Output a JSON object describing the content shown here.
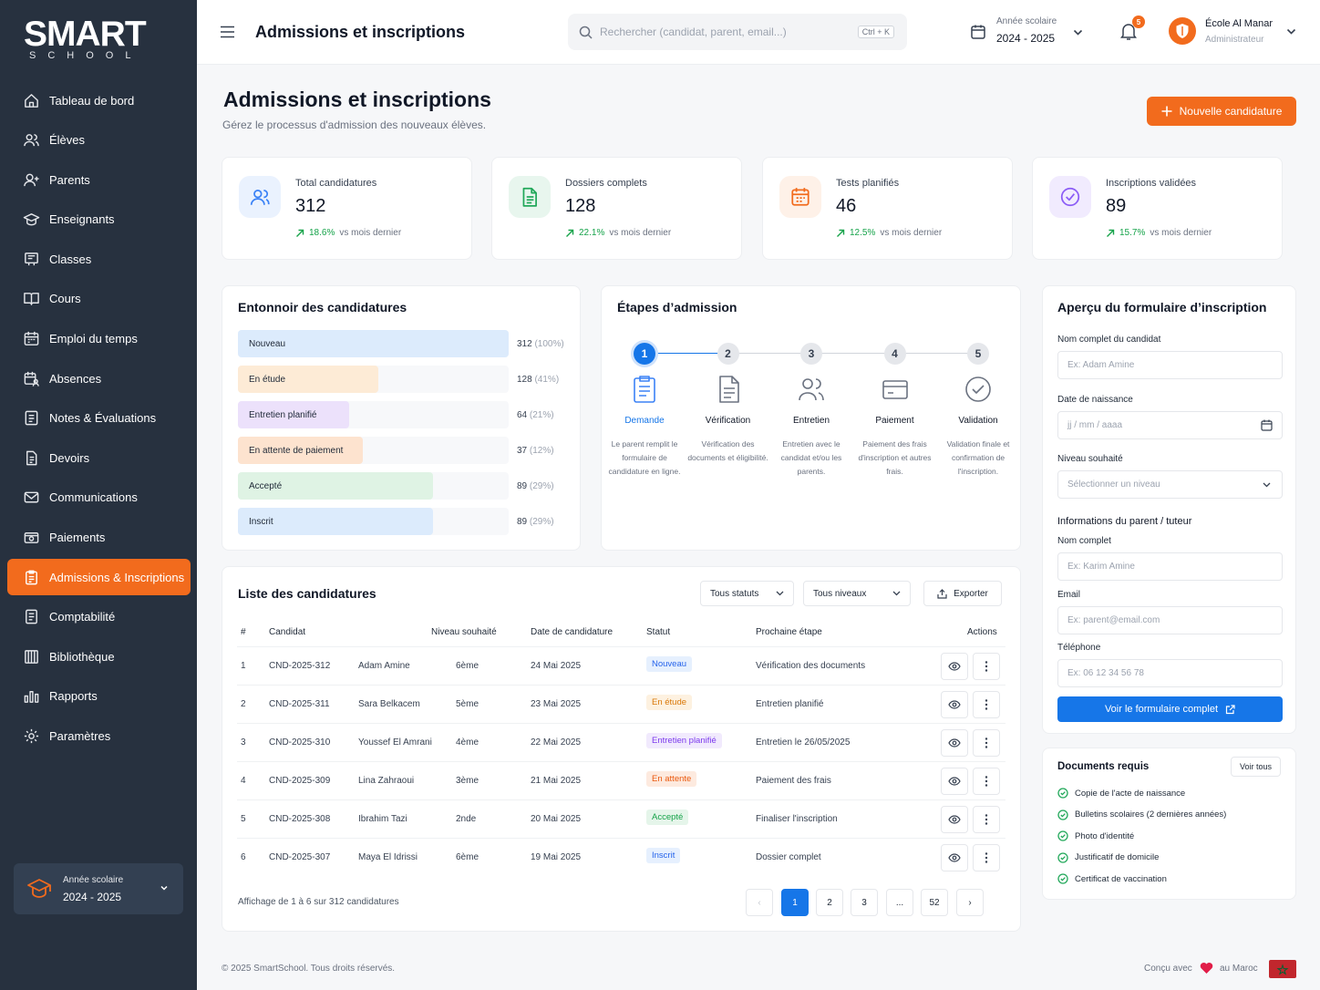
{
  "brand": {
    "name_main": "SMART",
    "name_sub": "SCHOOL"
  },
  "sidebar": {
    "items": [
      {
        "label": "Tableau de bord",
        "icon": "home-icon"
      },
      {
        "label": "Élèves",
        "icon": "users-icon"
      },
      {
        "label": "Parents",
        "icon": "user-plus-icon"
      },
      {
        "label": "Enseignants",
        "icon": "graduation-cap-icon"
      },
      {
        "label": "Classes",
        "icon": "board-icon"
      },
      {
        "label": "Cours",
        "icon": "book-icon"
      },
      {
        "label": "Emploi du temps",
        "icon": "calendar-icon"
      },
      {
        "label": "Absences",
        "icon": "calendar-user-icon"
      },
      {
        "label": "Notes & Évaluations",
        "icon": "notes-icon"
      },
      {
        "label": "Devoirs",
        "icon": "document-icon"
      },
      {
        "label": "Communications",
        "icon": "mail-icon"
      },
      {
        "label": "Paiements",
        "icon": "wallet-icon"
      },
      {
        "label": "Admissions & Inscriptions",
        "icon": "clipboard-icon",
        "active": true
      },
      {
        "label": "Comptabilité",
        "icon": "ledger-icon"
      },
      {
        "label": "Bibliothèque",
        "icon": "library-icon"
      },
      {
        "label": "Rapports",
        "icon": "bar-chart-icon"
      },
      {
        "label": "Paramètres",
        "icon": "gear-icon"
      }
    ],
    "year": {
      "label": "Année scolaire",
      "value": "2024 - 2025"
    }
  },
  "topbar": {
    "title": "Admissions et inscriptions",
    "search_placeholder": "Rechercher (candidat, parent, email...)",
    "shortcut": "Ctrl + K",
    "year_label": "Année scolaire",
    "year_value": "2024 - 2025",
    "notif_count": "5",
    "school_name": "École Al Manar",
    "role": "Administrateur"
  },
  "page": {
    "title": "Admissions et inscriptions",
    "subtitle": "Gérez le processus d'admission des nouveaux élèves.",
    "new_button": "Nouvelle candidature"
  },
  "stats": [
    {
      "label": "Total candidatures",
      "value": "312",
      "change": "18.6%",
      "suffix": "vs mois dernier",
      "color": "#3b82f6",
      "bg": "#eaf2fe"
    },
    {
      "label": "Dossiers complets",
      "value": "128",
      "change": "22.1%",
      "suffix": "vs mois dernier",
      "color": "#22a85a",
      "bg": "#e8f6ee"
    },
    {
      "label": "Tests planifiés",
      "value": "46",
      "change": "12.5%",
      "suffix": "vs mois dernier",
      "color": "#f26b1d",
      "bg": "#fef1e8"
    },
    {
      "label": "Inscriptions validées",
      "value": "89",
      "change": "15.7%",
      "suffix": "vs mois dernier",
      "color": "#8b5cf6",
      "bg": "#f1ebfe"
    }
  ],
  "funnel": {
    "title": "Entonnoir des candidatures",
    "rows": [
      {
        "label": "Nouveau",
        "count": "312",
        "pct": "(100%)",
        "fraction": 1.0,
        "color": "#dcebfc"
      },
      {
        "label": "En étude",
        "count": "128",
        "pct": "(41%)",
        "fraction": 0.52,
        "color": "#fdebd6"
      },
      {
        "label": "Entretien planifié",
        "count": "64",
        "pct": "(21%)",
        "fraction": 0.41,
        "color": "#ece1fb"
      },
      {
        "label": "En attente de paiement",
        "count": "37",
        "pct": "(12%)",
        "fraction": 0.46,
        "color": "#fde3cf"
      },
      {
        "label": "Accepté",
        "count": "89",
        "pct": "(29%)",
        "fraction": 0.72,
        "color": "#dff3e4"
      },
      {
        "label": "Inscrit",
        "count": "89",
        "pct": "(29%)",
        "fraction": 0.72,
        "color": "#dcebfc"
      }
    ]
  },
  "steps": {
    "title": "Étapes d’admission",
    "items": [
      {
        "num": "1",
        "title": "Demande",
        "desc": "Le parent remplit le formulaire de candidature en ligne.",
        "active": true
      },
      {
        "num": "2",
        "title": "Vérification",
        "desc": "Vérification des documents et éligibilité."
      },
      {
        "num": "3",
        "title": "Entretien",
        "desc": "Entretien avec le candidat et/ou les parents."
      },
      {
        "num": "4",
        "title": "Paiement",
        "desc": "Paiement des frais d'inscription et autres frais."
      },
      {
        "num": "5",
        "title": "Validation",
        "desc": "Validation finale et confirmation de l'inscription."
      }
    ]
  },
  "form": {
    "title": "Aperçu du formulaire d’inscription",
    "name_label": "Nom complet du candidat",
    "name_ph": "Ex: Adam Amine",
    "dob_label": "Date de naissance",
    "dob_ph": "jj / mm / aaaa",
    "level_label": "Niveau souhaité",
    "level_ph": "Sélectionner un niveau",
    "parent_section": "Informations du parent / tuteur",
    "pname_label": "Nom complet",
    "pname_ph": "Ex: Karim Amine",
    "email_label": "Email",
    "email_ph": "Ex: parent@email.com",
    "phone_label": "Téléphone",
    "phone_ph": "Ex: 06 12 34 56 78",
    "button": "Voir le formulaire complet"
  },
  "docs": {
    "title": "Documents requis",
    "see_all": "Voir tous",
    "items": [
      "Copie de l'acte de naissance",
      "Bulletins scolaires (2 dernières années)",
      "Photo d'identité",
      "Justificatif de domicile",
      "Certificat de vaccination"
    ]
  },
  "table": {
    "title": "Liste des candidatures",
    "filter_status": "Tous statuts",
    "filter_level": "Tous niveaux",
    "export": "Exporter",
    "headers": [
      "#",
      "Candidat",
      "Niveau souhaité",
      "Date de candidature",
      "Statut",
      "Prochaine étape",
      "Actions"
    ],
    "rows": [
      {
        "n": "1",
        "id": "CND-2025-312",
        "name": "Adam Amine",
        "level": "6ème",
        "date": "24 Mai 2025",
        "status": "Nouveau",
        "sfg": "#2563eb",
        "sbg": "#e6f0fe",
        "next": "Vérification des documents"
      },
      {
        "n": "2",
        "id": "CND-2025-311",
        "name": "Sara Belkacem",
        "level": "5ème",
        "date": "23 Mai 2025",
        "status": "En étude",
        "sfg": "#d97706",
        "sbg": "#fdf1e0",
        "next": "Entretien planifié"
      },
      {
        "n": "3",
        "id": "CND-2025-310",
        "name": "Youssef El Amrani",
        "level": "4ème",
        "date": "22 Mai 2025",
        "status": "Entretien planifié",
        "sfg": "#7c3aed",
        "sbg": "#f1eafd",
        "next": "Entretien le 26/05/2025"
      },
      {
        "n": "4",
        "id": "CND-2025-309",
        "name": "Lina Zahraoui",
        "level": "3ème",
        "date": "21 Mai 2025",
        "status": "En attente",
        "sfg": "#ea580c",
        "sbg": "#fdeadf",
        "next": "Paiement des frais"
      },
      {
        "n": "5",
        "id": "CND-2025-308",
        "name": "Ibrahim Tazi",
        "level": "2nde",
        "date": "20 Mai 2025",
        "status": "Accepté",
        "sfg": "#16a34a",
        "sbg": "#e5f5ea",
        "next": "Finaliser l'inscription"
      },
      {
        "n": "6",
        "id": "CND-2025-307",
        "name": "Maya El Idrissi",
        "level": "6ème",
        "date": "19 Mai 2025",
        "status": "Inscrit",
        "sfg": "#2563eb",
        "sbg": "#e6f0fe",
        "next": "Dossier complet"
      }
    ],
    "summary": "Affichage de 1 à 6 sur 312 candidatures",
    "pages": [
      "‹",
      "1",
      "2",
      "3",
      "...",
      "52",
      "›"
    ]
  },
  "footer": {
    "copyright": "© 2025 SmartSchool. Tous droits réservés.",
    "made_with": "Conçu avec",
    "made_in": "au Maroc"
  }
}
